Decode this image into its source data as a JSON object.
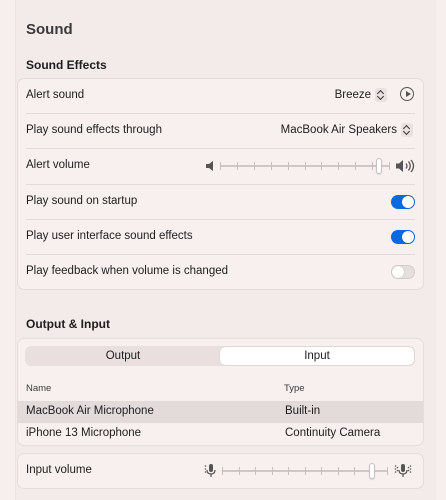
{
  "title": "Sound",
  "sound_effects": {
    "section_title": "Sound Effects",
    "alert_sound": {
      "label": "Alert sound",
      "value": "Breeze"
    },
    "play_through": {
      "label": "Play sound effects through",
      "value": "MacBook Air Speakers"
    },
    "alert_volume": {
      "label": "Alert volume",
      "level": 0.95
    },
    "startup": {
      "label": "Play sound on startup",
      "on": true
    },
    "ui_sounds": {
      "label": "Play user interface sound effects",
      "on": true
    },
    "feedback": {
      "label": "Play feedback when volume is changed",
      "on": false
    }
  },
  "output_input": {
    "section_title": "Output & Input",
    "tabs": [
      {
        "label": "Output",
        "selected": false
      },
      {
        "label": "Input",
        "selected": true
      }
    ],
    "columns": [
      "Name",
      "Type"
    ],
    "devices": [
      {
        "name": "MacBook Air Microphone",
        "type": "Built-in",
        "selected": true
      },
      {
        "name": "iPhone 13 Microphone",
        "type": "Continuity Camera",
        "selected": false
      }
    ],
    "input_volume": {
      "label": "Input volume",
      "level": 0.92
    }
  },
  "colors": {
    "accent": "#0a68e0",
    "background": "#f6efee"
  },
  "icons": [
    "play-icon",
    "speaker-low-icon",
    "speaker-high-icon",
    "mic-low-icon",
    "mic-high-icon",
    "chevron-updown-icon"
  ]
}
